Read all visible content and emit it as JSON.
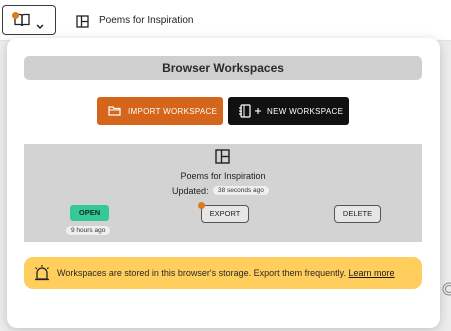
{
  "topbar": {
    "workspace_toggle": {
      "icons": [
        "book-icon",
        "chevron-down-icon"
      ],
      "indicator_color": "#e0781e"
    },
    "active_tab": {
      "icon": "layout-panels-icon",
      "title": "Poems for Inspiration"
    }
  },
  "panel": {
    "header": "Browser Workspaces",
    "actions": {
      "import_label": "IMPORT WORKSPACE",
      "import_icon": "folder-icon",
      "import_color": "#d4651a",
      "new_label": "NEW WORKSPACE",
      "new_icon": "notebook-plus-icon",
      "new_color": "#111111"
    },
    "workspaces": [
      {
        "icon": "layout-panels-icon",
        "title": "Poems for Inspiration",
        "updated_label": "Updated:",
        "updated_value": "38 seconds ago",
        "open_label": "OPEN",
        "open_color": "#35c99a",
        "opened_value": "9 hours ago",
        "export_label": "EXPORT",
        "export_indicator_color": "#e0781e",
        "delete_label": "DELETE"
      }
    ],
    "notice": {
      "icon": "alarm-alert-icon",
      "text": "Workspaces are stored in this browser's storage. Export them frequently.",
      "link": "Learn more",
      "color": "#ffce5c"
    }
  }
}
